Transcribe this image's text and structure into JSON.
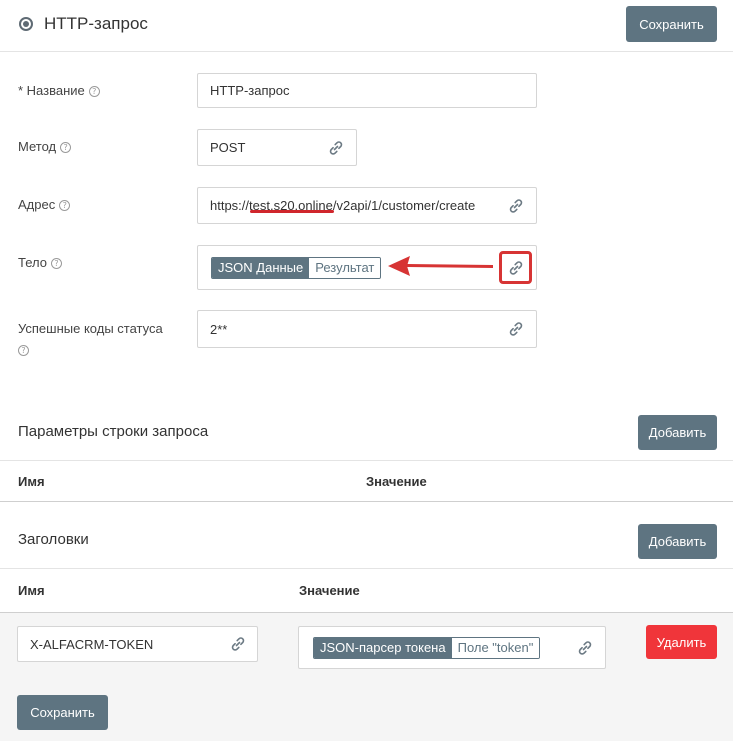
{
  "header": {
    "title": "HTTP-запрос",
    "save_label": "Сохранить"
  },
  "fields": {
    "name": {
      "label": "* Название",
      "value": "HTTP-запрос"
    },
    "method": {
      "label": "Метод",
      "value": "POST"
    },
    "address": {
      "label": "Адрес",
      "value": "https://test.s20.online/v2api/1/customer/create"
    },
    "body": {
      "label": "Тело",
      "tag_main": "JSON Данные",
      "tag_sub": "Результат"
    },
    "status_codes": {
      "label": "Успешные коды статуса",
      "value": "2**"
    }
  },
  "query_params": {
    "title": "Параметры строки запроса",
    "add_label": "Добавить",
    "col_name": "Имя",
    "col_value": "Значение"
  },
  "headers_section": {
    "title": "Заголовки",
    "add_label": "Добавить",
    "col_name": "Имя",
    "col_value": "Значение",
    "rows": [
      {
        "name": "X-ALFACRM-TOKEN",
        "tag_main": "JSON-парсер токена",
        "tag_sub": "Поле \"token\"",
        "delete_label": "Удалить"
      }
    ]
  },
  "footer": {
    "save_label": "Сохранить"
  },
  "colors": {
    "button": "#5e7481",
    "delete": "#f0353a",
    "highlight": "#d73434"
  },
  "icons": {
    "header": "radio-icon",
    "help": "help-icon",
    "link": "link-icon",
    "annotation": "red-arrow"
  }
}
